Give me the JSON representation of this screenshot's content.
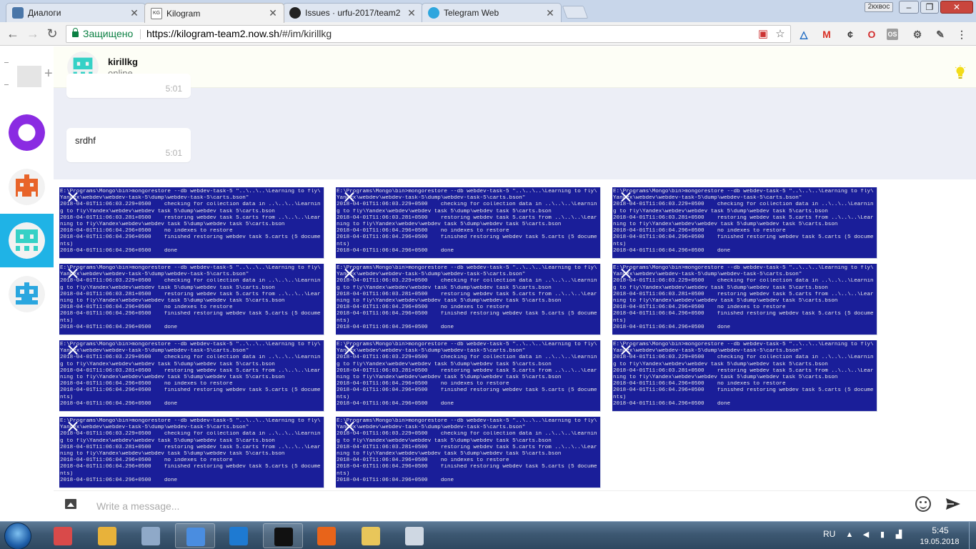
{
  "browser": {
    "tabs": [
      {
        "title": "Диалоги",
        "icon": "dialogs-icon"
      },
      {
        "title": "Kilogram",
        "icon": "kilogram-icon"
      },
      {
        "title": "Issues · urfu-2017/team2",
        "icon": "github-icon"
      },
      {
        "title": "Telegram Web",
        "icon": "telegram-icon"
      }
    ],
    "profile_label": "2кхвос",
    "security_label": "Защищено",
    "url_origin": "https://kilogram-team2.now.sh",
    "url_path": "/#/im/kirillkg",
    "colors": {
      "secure": "#0b8043",
      "tabstrip": "#c8d6ea"
    }
  },
  "sidebar": {
    "dialogs": [
      {
        "name": "purple-ring-avatar",
        "color": "#8a2be2"
      },
      {
        "name": "orange-bot-avatar",
        "color": "#e8642a"
      },
      {
        "name": "teal-bot-avatar",
        "color": "#35d1c6",
        "active": true
      },
      {
        "name": "blue-bot-avatar",
        "color": "#2aa6df"
      }
    ],
    "colors": {
      "active": "#1fb3e6"
    }
  },
  "chat": {
    "contact_name": "kirillkg",
    "contact_status": "online",
    "messages": [
      {
        "text": "",
        "time": "5:01"
      },
      {
        "text": "srdhf",
        "time": "5:01"
      }
    ],
    "attachment_rows": [
      3,
      3,
      3,
      2
    ],
    "attachment_colors": {
      "bg": "#1a1e99",
      "text": "#e6e6e6"
    },
    "console_lines": [
      "E:\\Programs\\Mongo\\bin>mongorestore --db webdev-task-5 \"..\\..\\..\\Learning to fly\\",
      "Yandex\\webdev\\webdev-task-5\\dump\\webdev-task-5\\carts.bson\"",
      "2018-04-01T11:06:03.229+0500    checking for collection data in ..\\..\\..\\Learnin",
      "g to fly\\Yandex\\webdev\\webdev task 5\\dump\\webdev task 5\\carts.bson",
      "2018-04-01T11:06:03.281+0500    restoring webdev task 5.carts from ..\\..\\..\\Lear",
      "ning to fly\\Yandex\\webdev\\webdev task 5\\dump\\webdev task 5\\carts.bson",
      "2018-04-01T11:06:04.296+0500    no indexes to restore",
      "2018-04-01T11:06:04.296+0500    finished restoring webdev task 5.carts (5 docume",
      "nts)",
      "2018-04-01T11:06:04.296+0500    done"
    ],
    "input_placeholder": "Write a message..."
  },
  "taskbar": {
    "apps": [
      {
        "name": "paint-icon",
        "color": "#d94a4a"
      },
      {
        "name": "palette-icon",
        "color": "#e8b23a"
      },
      {
        "name": "calculator-icon",
        "color": "#8fa9c8"
      },
      {
        "name": "chrome-icon",
        "color": "#4a8de0",
        "open": true
      },
      {
        "name": "vscode-icon",
        "color": "#1e7ad2"
      },
      {
        "name": "cmd-icon",
        "color": "#111111",
        "open": true
      },
      {
        "name": "firefox-icon",
        "color": "#e8641a"
      },
      {
        "name": "explorer-icon",
        "color": "#e8c65a"
      },
      {
        "name": "monitor-icon",
        "color": "#cfd8e3"
      }
    ],
    "language": "RU",
    "time": "5:45",
    "date": "19.05.2018"
  }
}
